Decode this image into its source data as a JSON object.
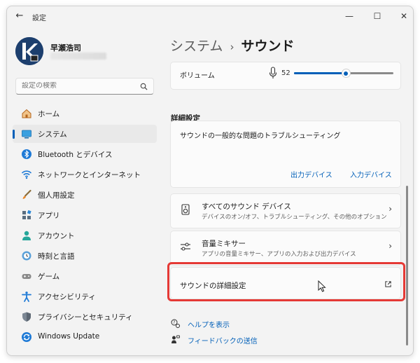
{
  "window": {
    "title": "設定"
  },
  "profile": {
    "name": "早瀬浩司"
  },
  "search": {
    "placeholder": "設定の検索"
  },
  "nav": {
    "items": [
      {
        "label": "ホーム",
        "icon": "home-icon"
      },
      {
        "label": "システム",
        "icon": "system-icon",
        "active": true
      },
      {
        "label": "Bluetooth とデバイス",
        "icon": "bluetooth-icon"
      },
      {
        "label": "ネットワークとインターネット",
        "icon": "network-icon"
      },
      {
        "label": "個人用設定",
        "icon": "personalization-icon"
      },
      {
        "label": "アプリ",
        "icon": "apps-icon"
      },
      {
        "label": "アカウント",
        "icon": "account-icon"
      },
      {
        "label": "時刻と言語",
        "icon": "time-language-icon"
      },
      {
        "label": "ゲーム",
        "icon": "gaming-icon"
      },
      {
        "label": "アクセシビリティ",
        "icon": "accessibility-icon"
      },
      {
        "label": "プライバシーとセキュリティ",
        "icon": "privacy-icon"
      },
      {
        "label": "Windows Update",
        "icon": "windows-update-icon"
      }
    ]
  },
  "breadcrumb": {
    "parent": "システム",
    "separator": "›",
    "current": "サウンド"
  },
  "volume": {
    "label": "ボリューム",
    "value": "52",
    "level_percent": 52
  },
  "advanced": {
    "heading": "詳細設定",
    "troubleshoot": {
      "title": "サウンドの一般的な問題のトラブルシューティング",
      "output_button": "出力デバイス",
      "input_button": "入力デバイス"
    },
    "all_devices": {
      "title": "すべてのサウンド デバイス",
      "subtitle": "デバイスのオン/オフ、トラブルシューティング、その他のオプション"
    },
    "mixer": {
      "title": "音量ミキサー",
      "subtitle": "アプリの音量ミキサー、アプリの入力および出力デバイス"
    },
    "more_sound": {
      "title": "サウンドの詳細設定"
    }
  },
  "footer": {
    "help": "ヘルプを表示",
    "feedback": "フィードバックの送信"
  },
  "colors": {
    "accent": "#005fb8",
    "highlight": "#e53935",
    "background": "#f3f3f3"
  }
}
